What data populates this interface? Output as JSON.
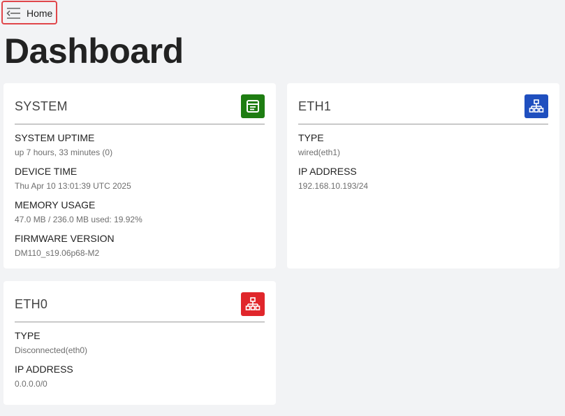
{
  "nav": {
    "home_label": "Home"
  },
  "page": {
    "title": "Dashboard"
  },
  "cards": {
    "system": {
      "title": "SYSTEM",
      "badge_color": "#1e7d12",
      "badge_icon": "panel-icon",
      "fields": [
        {
          "label": "SYSTEM UPTIME",
          "value": "up 7 hours, 33 minutes (0)"
        },
        {
          "label": "DEVICE TIME",
          "value": "Thu Apr 10 13:01:39 UTC 2025"
        },
        {
          "label": "MEMORY USAGE",
          "value": "47.0 MB / 236.0 MB used: 19.92%"
        },
        {
          "label": "FIRMWARE VERSION",
          "value": "DM110_s19.06p68-M2"
        }
      ]
    },
    "eth1": {
      "title": "ETH1",
      "badge_color": "#1f4fbf",
      "badge_icon": "network-icon",
      "fields": [
        {
          "label": "TYPE",
          "value": "wired(eth1)"
        },
        {
          "label": "IP ADDRESS",
          "value": "192.168.10.193/24"
        }
      ]
    },
    "eth0": {
      "title": "ETH0",
      "badge_color": "#e0262b",
      "badge_icon": "network-icon",
      "fields": [
        {
          "label": "TYPE",
          "value": "Disconnected(eth0)"
        },
        {
          "label": "IP ADDRESS",
          "value": "0.0.0.0/0"
        }
      ]
    }
  }
}
